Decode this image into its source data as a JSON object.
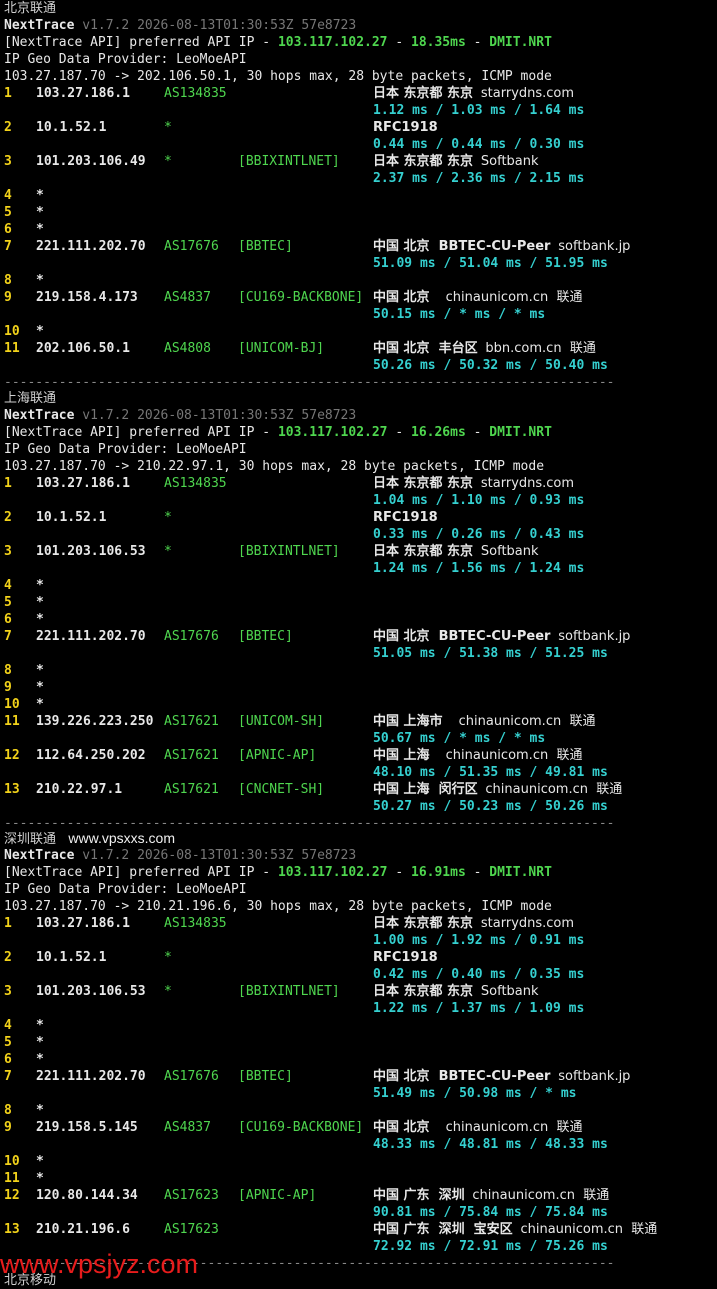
{
  "watermark": "www.vpsjyz.com",
  "sections": [
    {
      "title": "北京联通",
      "site": "",
      "version": "v1.7.2 2026-08-13T01:30:53Z 57e8723",
      "api_prefix": "[NextTrace API] preferred API IP - ",
      "api_ip": "103.117.102.27",
      "api_ms": "18.35ms",
      "api_node": "DMIT.NRT",
      "geo_provider": "IP Geo Data Provider: LeoMoeAPI",
      "header": "103.27.187.70 -> 202.106.50.1, 30 hops max, 28 byte packets, ICMP mode",
      "hops": [
        {
          "n": "1",
          "ip": "103.27.186.1",
          "as": "AS134835",
          "tag": "",
          "geo": "日本 东京都 东京",
          "host": "starrydns.com",
          "rtt": "1.12 ms / 1.03 ms / 1.64 ms"
        },
        {
          "n": "2",
          "ip": "10.1.52.1",
          "as": "*",
          "tag": "",
          "geo": "RFC1918",
          "host": "",
          "rtt": "0.44 ms / 0.44 ms / 0.30 ms"
        },
        {
          "n": "3",
          "ip": "101.203.106.49",
          "as": "*",
          "tag": "[BBIXINTLNET]",
          "geo": "日本 东京都 东京",
          "host": "Softbank",
          "rtt": "2.37 ms / 2.36 ms / 2.15 ms"
        },
        {
          "n": "4",
          "ip": "*"
        },
        {
          "n": "5",
          "ip": "*"
        },
        {
          "n": "6",
          "ip": "*"
        },
        {
          "n": "7",
          "ip": "221.111.202.70",
          "as": "AS17676",
          "tag": "[BBTEC]",
          "geo": "中国 北京  BBTEC-CU-Peer",
          "host": "softbank.jp",
          "rtt": "51.09 ms / 51.04 ms / 51.95 ms"
        },
        {
          "n": "8",
          "ip": "*"
        },
        {
          "n": "9",
          "ip": "219.158.4.173",
          "as": "AS4837",
          "tag": "[CU169-BACKBONE]",
          "geo": "中国 北京",
          "host": "  chinaunicom.cn  联通",
          "rtt": "50.15 ms / * ms / * ms"
        },
        {
          "n": "10",
          "ip": "*"
        },
        {
          "n": "11",
          "ip": "202.106.50.1",
          "as": "AS4808",
          "tag": "[UNICOM-BJ]",
          "geo": "中国 北京  丰台区",
          "host": "bbn.com.cn  联通",
          "rtt": "50.26 ms / 50.32 ms / 50.40 ms"
        }
      ]
    },
    {
      "title": "上海联通",
      "site": "",
      "version": "v1.7.2 2026-08-13T01:30:53Z 57e8723",
      "api_prefix": "[NextTrace API] preferred API IP - ",
      "api_ip": "103.117.102.27",
      "api_ms": "16.26ms",
      "api_node": "DMIT.NRT",
      "geo_provider": "IP Geo Data Provider: LeoMoeAPI",
      "header": "103.27.187.70 -> 210.22.97.1, 30 hops max, 28 byte packets, ICMP mode",
      "hops": [
        {
          "n": "1",
          "ip": "103.27.186.1",
          "as": "AS134835",
          "tag": "",
          "geo": "日本 东京都 东京",
          "host": "starrydns.com",
          "rtt": "1.04 ms / 1.10 ms / 0.93 ms"
        },
        {
          "n": "2",
          "ip": "10.1.52.1",
          "as": "*",
          "tag": "",
          "geo": "RFC1918",
          "host": "",
          "rtt": "0.33 ms / 0.26 ms / 0.43 ms"
        },
        {
          "n": "3",
          "ip": "101.203.106.53",
          "as": "*",
          "tag": "[BBIXINTLNET]",
          "geo": "日本 东京都 东京",
          "host": "Softbank",
          "rtt": "1.24 ms / 1.56 ms / 1.24 ms"
        },
        {
          "n": "4",
          "ip": "*"
        },
        {
          "n": "5",
          "ip": "*"
        },
        {
          "n": "6",
          "ip": "*"
        },
        {
          "n": "7",
          "ip": "221.111.202.70",
          "as": "AS17676",
          "tag": "[BBTEC]",
          "geo": "中国 北京  BBTEC-CU-Peer",
          "host": "softbank.jp",
          "rtt": "51.05 ms / 51.38 ms / 51.25 ms"
        },
        {
          "n": "8",
          "ip": "*"
        },
        {
          "n": "9",
          "ip": "*"
        },
        {
          "n": "10",
          "ip": "*"
        },
        {
          "n": "11",
          "ip": "139.226.223.250",
          "as": "AS17621",
          "tag": "[UNICOM-SH]",
          "geo": "中国 上海市",
          "host": "  chinaunicom.cn  联通",
          "rtt": "50.67 ms / * ms / * ms"
        },
        {
          "n": "12",
          "ip": "112.64.250.202",
          "as": "AS17621",
          "tag": "[APNIC-AP]",
          "geo": "中国 上海",
          "host": "  chinaunicom.cn  联通",
          "rtt": "48.10 ms / 51.35 ms / 49.81 ms"
        },
        {
          "n": "13",
          "ip": "210.22.97.1",
          "as": "AS17621",
          "tag": "[CNCNET-SH]",
          "geo": "中国 上海  闵行区",
          "host": "chinaunicom.cn  联通",
          "rtt": "50.27 ms / 50.23 ms / 50.26 ms"
        }
      ]
    },
    {
      "title": "深圳联通",
      "site": "www.vpsxxs.com",
      "version": "v1.7.2 2026-08-13T01:30:53Z 57e8723",
      "api_prefix": "[NextTrace API] preferred API IP - ",
      "api_ip": "103.117.102.27",
      "api_ms": "16.91ms",
      "api_node": "DMIT.NRT",
      "geo_provider": "IP Geo Data Provider: LeoMoeAPI",
      "header": "103.27.187.70 -> 210.21.196.6, 30 hops max, 28 byte packets, ICMP mode",
      "hops": [
        {
          "n": "1",
          "ip": "103.27.186.1",
          "as": "AS134835",
          "tag": "",
          "geo": "日本 东京都 东京",
          "host": "starrydns.com",
          "rtt": "1.00 ms / 1.92 ms / 0.91 ms"
        },
        {
          "n": "2",
          "ip": "10.1.52.1",
          "as": "*",
          "tag": "",
          "geo": "RFC1918",
          "host": "",
          "rtt": "0.42 ms / 0.40 ms / 0.35 ms"
        },
        {
          "n": "3",
          "ip": "101.203.106.53",
          "as": "*",
          "tag": "[BBIXINTLNET]",
          "geo": "日本 东京都 东京",
          "host": "Softbank",
          "rtt": "1.22 ms / 1.37 ms / 1.09 ms"
        },
        {
          "n": "4",
          "ip": "*"
        },
        {
          "n": "5",
          "ip": "*"
        },
        {
          "n": "6",
          "ip": "*"
        },
        {
          "n": "7",
          "ip": "221.111.202.70",
          "as": "AS17676",
          "tag": "[BBTEC]",
          "geo": "中国 北京  BBTEC-CU-Peer",
          "host": "softbank.jp",
          "rtt": "51.49 ms / 50.98 ms / * ms"
        },
        {
          "n": "8",
          "ip": "*"
        },
        {
          "n": "9",
          "ip": "219.158.5.145",
          "as": "AS4837",
          "tag": "[CU169-BACKBONE]",
          "geo": "中国 北京",
          "host": "  chinaunicom.cn  联通",
          "rtt": "48.33 ms / 48.81 ms / 48.33 ms"
        },
        {
          "n": "10",
          "ip": "*"
        },
        {
          "n": "11",
          "ip": "*"
        },
        {
          "n": "12",
          "ip": "120.80.144.34",
          "as": "AS17623",
          "tag": "[APNIC-AP]",
          "geo": "中国 广东  深圳",
          "host": "chinaunicom.cn  联通",
          "rtt": "90.81 ms / 75.84 ms / 75.84 ms"
        },
        {
          "n": "13",
          "ip": "210.21.196.6",
          "as": "AS17623",
          "tag": "",
          "geo": "中国 广东  深圳  宝安区",
          "host": "chinaunicom.cn  联通",
          "rtt": "72.92 ms / 72.91 ms / 75.26 ms"
        }
      ]
    }
  ],
  "next_title": "北京移动"
}
